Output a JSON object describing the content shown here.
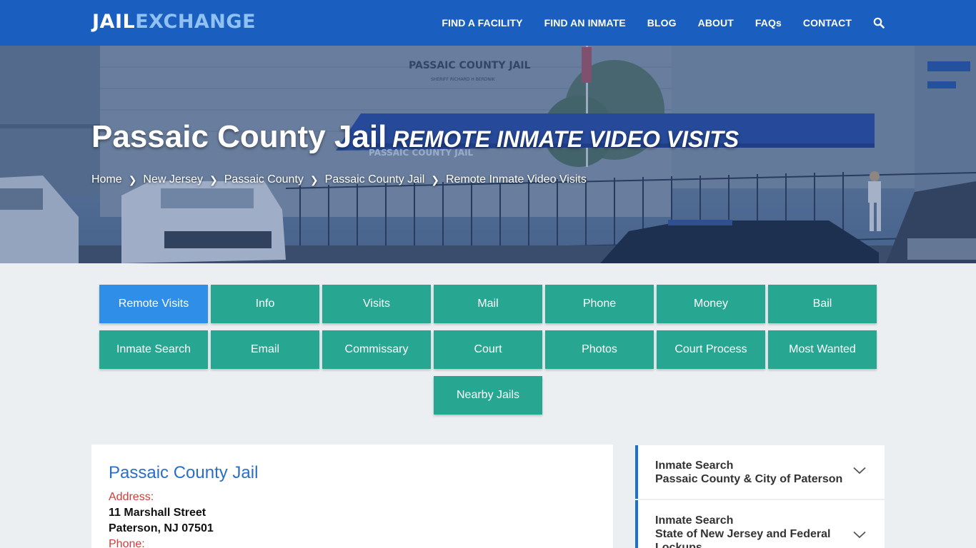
{
  "header": {
    "logo_part1": "JAIL",
    "logo_part2": "EXCHANGE",
    "nav": [
      "FIND A FACILITY",
      "FIND AN INMATE",
      "BLOG",
      "ABOUT",
      "FAQs",
      "CONTACT"
    ]
  },
  "hero": {
    "title": "Passaic County Jail",
    "subtitle": "REMOTE INMATE VIDEO VISITS",
    "breadcrumbs": [
      "Home",
      "New Jersey",
      "Passaic County",
      "Passaic County Jail"
    ],
    "breadcrumb_current": "Remote Inmate Video Visits",
    "sign_line1": "PASSAIC COUNTY JAIL",
    "sign_line2": "SHERIFF RICHARD H BERDNIK",
    "awning_text": "PASSAIC COUNTY JAIL"
  },
  "buttons": {
    "row1": [
      "Remote Visits",
      "Info",
      "Visits",
      "Mail",
      "Phone",
      "Money",
      "Bail"
    ],
    "row2": [
      "Inmate Search",
      "Email",
      "Commissary",
      "Court",
      "Photos",
      "Court Process",
      "Most Wanted"
    ],
    "row3": [
      "Nearby Jails"
    ]
  },
  "card": {
    "title": "Passaic County Jail",
    "address_label": "Address:",
    "address_line1": "11 Marshall Street",
    "address_line2": "Paterson, NJ 07501",
    "phone_label": "Phone:"
  },
  "sidebar": [
    {
      "title": "Inmate Search",
      "subtitle": "Passaic County & City of Paterson"
    },
    {
      "title": "Inmate Search",
      "subtitle": "State of New Jersey and Federal Lockups"
    }
  ],
  "colors": {
    "header": "#1a5fbf",
    "button": "#27a692",
    "button_active": "#2f8ee8",
    "card_title": "#2a6fc4",
    "label_red": "#d43a3a"
  }
}
